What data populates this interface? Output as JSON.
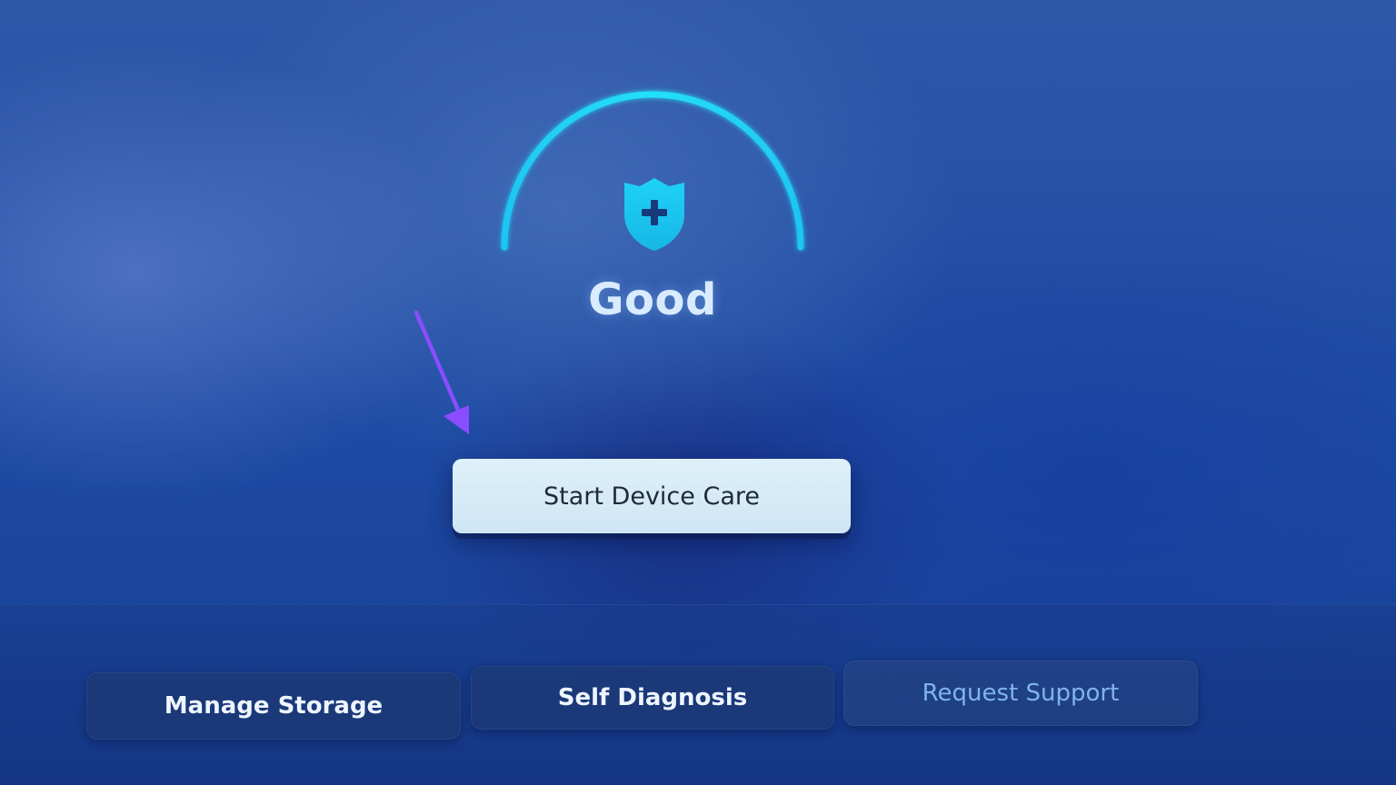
{
  "status": {
    "label": "Good",
    "icon": "shield-plus-icon",
    "accent_color": "#19d3f5"
  },
  "primary_action": {
    "label": "Start Device Care"
  },
  "annotation": {
    "icon": "pointer-arrow-icon",
    "color": "#8a4dff"
  },
  "bottom_menu": {
    "items": [
      {
        "label": "Manage Storage"
      },
      {
        "label": "Self Diagnosis"
      },
      {
        "label": "Request Support"
      }
    ]
  }
}
